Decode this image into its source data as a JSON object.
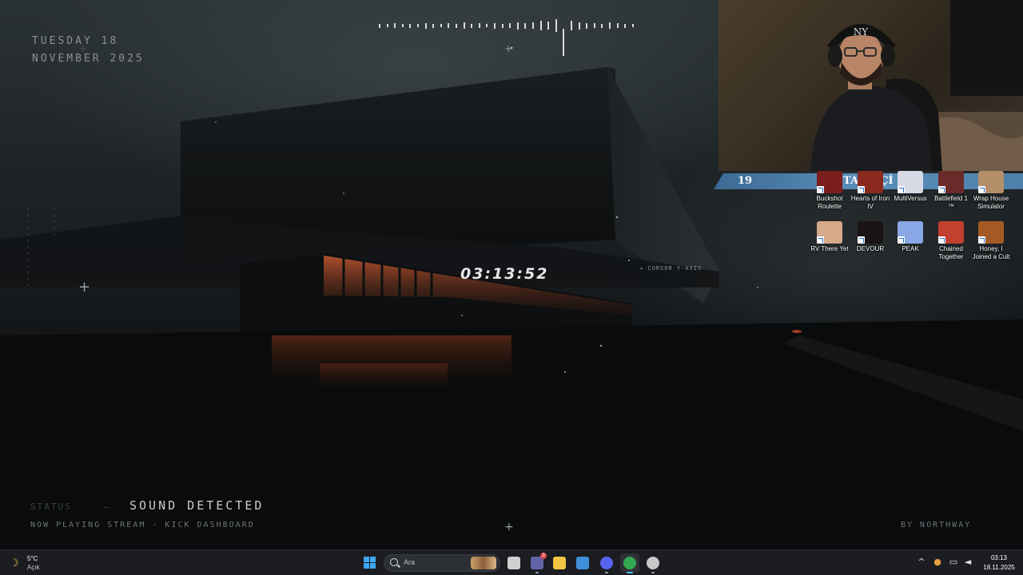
{
  "overlay": {
    "date_day": "TUESDAY 18",
    "date_month": "NOVEMBER 2025",
    "clock": "03:13:52",
    "cursor_label": "◂  CURSOR Y-AXIS",
    "status_label": "STATUS",
    "status_dash": "—",
    "status_value": "SOUND DETECTED",
    "now_playing": "NOW PLAYING  STREAM - KICK DASHBOARD",
    "credit": "BY NORTHWAY"
  },
  "follower_bar": {
    "left_count": "19",
    "title": "TAKİPÇİ",
    "right_count": "30",
    "color": "#4d7fa9"
  },
  "desktop_icons": [
    {
      "label": "Buckshot Roulette",
      "icon": "buckshot-roulette-icon",
      "color": "#7a1d1d"
    },
    {
      "label": "Hearts of Iron IV",
      "icon": "hearts-of-iron-icon",
      "color": "#8a2a1e"
    },
    {
      "label": "MultiVersus",
      "icon": "multiversus-icon",
      "color": "#d8dbe6"
    },
    {
      "label": "Battlefield 1 ™",
      "icon": "battlefield-icon",
      "color": "#6b2a2a"
    },
    {
      "label": "Wrap House Simulator",
      "icon": "wrap-house-icon",
      "color": "#b58f6a"
    },
    {
      "label": "RV There Yet",
      "icon": "rv-there-yet-icon",
      "color": "#d6a98a"
    },
    {
      "label": "DEVOUR",
      "icon": "devour-icon",
      "color": "#1a1414"
    },
    {
      "label": "PEAK",
      "icon": "peak-icon",
      "color": "#8aa7e6"
    },
    {
      "label": "Chained Together",
      "icon": "chained-together-icon",
      "color": "#c2402e"
    },
    {
      "label": "Honey, I Joined a Cult",
      "icon": "joined-cult-icon",
      "color": "#a55a26"
    }
  ],
  "taskbar": {
    "weather_temp": "5°C",
    "weather_condition": "Açık",
    "search_placeholder": "Ara",
    "apps": [
      {
        "name": "task-view",
        "color": "#d0d0d0"
      },
      {
        "name": "teams",
        "color": "#6264a7",
        "badge": "3"
      },
      {
        "name": "file-explorer",
        "color": "#f4c542"
      },
      {
        "name": "photos",
        "color": "#3d8fd9"
      },
      {
        "name": "discord",
        "color": "#5865f2"
      },
      {
        "name": "chrome",
        "color": "#34a853"
      },
      {
        "name": "obs",
        "color": "#c8c8c8"
      }
    ],
    "time": "03:13",
    "date": "18.11.2025",
    "accent": "#4cc2ff"
  }
}
